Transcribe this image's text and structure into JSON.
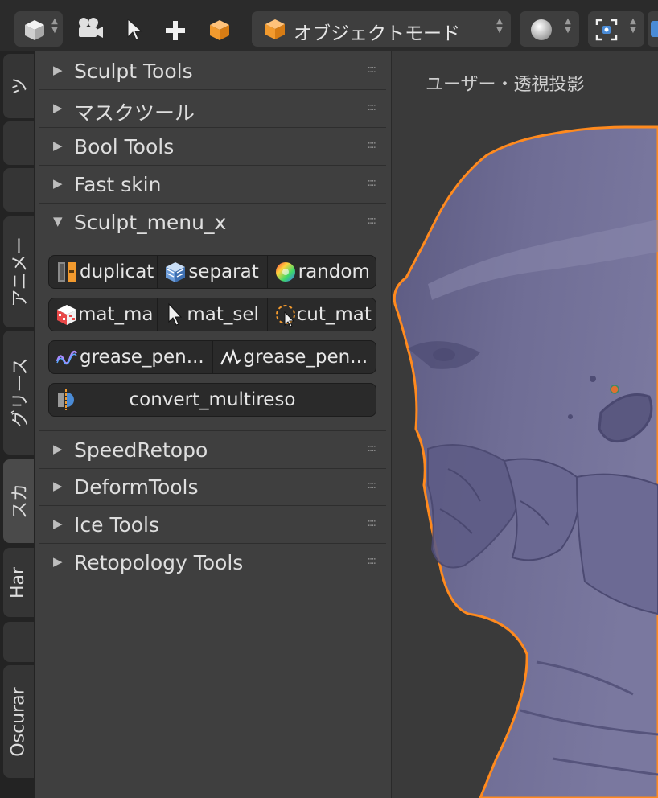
{
  "header": {
    "mode_label": "オブジェクトモード"
  },
  "tabs": [
    {
      "label": "ツ"
    },
    {
      "label": ""
    },
    {
      "label": ""
    },
    {
      "label": "アニメー"
    },
    {
      "label": "グリース"
    },
    {
      "label": "スカ"
    },
    {
      "label": "Har"
    },
    {
      "label": ""
    },
    {
      "label": "Oscurar"
    }
  ],
  "panels_top": [
    {
      "title": "Sculpt Tools",
      "expanded": false
    },
    {
      "title": "マスクツール",
      "expanded": false
    },
    {
      "title": "Bool Tools",
      "expanded": false
    },
    {
      "title": "Fast skin",
      "expanded": false
    },
    {
      "title": "Sculpt_menu_x",
      "expanded": true
    }
  ],
  "sculpt_menu": {
    "row1": [
      {
        "label": "duplicat",
        "icon": "duplicate-icon"
      },
      {
        "label": "separat",
        "icon": "separate-cube-icon"
      },
      {
        "label": "random",
        "icon": "color-wheel-icon"
      }
    ],
    "row2": [
      {
        "label": "mat_ma",
        "icon": "material-checker-cube-icon"
      },
      {
        "label": "mat_sel",
        "icon": "cursor-arrow-icon"
      },
      {
        "label": "cut_mat",
        "icon": "lasso-cut-icon"
      }
    ],
    "row3": [
      {
        "label": "grease_pen...",
        "icon": "wave-stroke-icon"
      },
      {
        "label": "grease_pen...",
        "icon": "peak-stroke-icon"
      }
    ],
    "row4": [
      {
        "label": "convert_multireso",
        "icon": "multires-icon"
      }
    ]
  },
  "panels_bottom": [
    {
      "title": "SpeedRetopo",
      "expanded": false
    },
    {
      "title": "DeformTools",
      "expanded": false
    },
    {
      "title": "Ice Tools",
      "expanded": false
    },
    {
      "title": "Retopology Tools",
      "expanded": false
    }
  ],
  "viewport": {
    "label": "ユーザー・透視投影",
    "outline_color": "#ff8a1e",
    "mesh_color": "#6a6890"
  },
  "colors": {
    "panel_bg": "#3f3f3f",
    "button_bg": "#2a2a2a",
    "selection_orange": "#ff8a1e"
  },
  "icons": {
    "collapsed": "▶",
    "expanded": "▼",
    "grip": "::::"
  }
}
